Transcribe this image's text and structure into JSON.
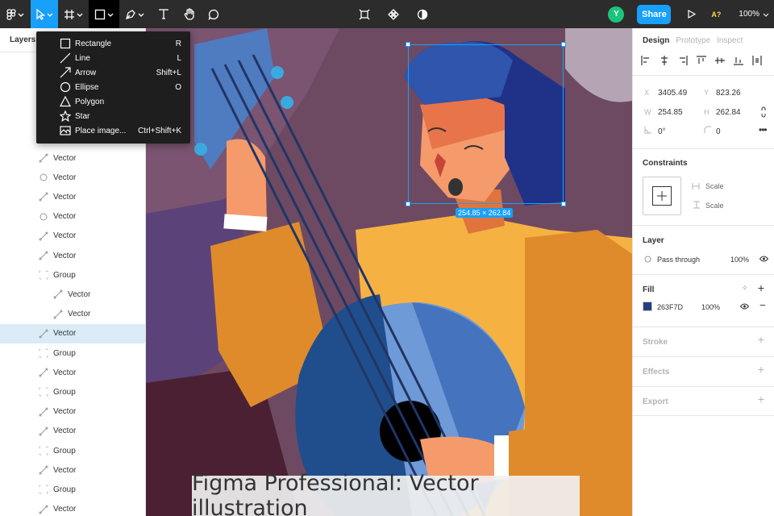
{
  "toolbar": {
    "zoom": "100%",
    "share_label": "Share",
    "avatar_initial": "Y",
    "badge": "A?"
  },
  "left_panel": {
    "header": "Layers",
    "layers": [
      {
        "label": "Vector",
        "icon": "vector-icon"
      },
      {
        "label": "Vector",
        "icon": "ellipse-icon"
      },
      {
        "label": "Vector",
        "icon": "vector-icon"
      },
      {
        "label": "Vector",
        "icon": "ellipse-icon"
      },
      {
        "label": "Vector",
        "icon": "vector-icon"
      },
      {
        "label": "Vector",
        "icon": "vector-icon"
      },
      {
        "label": "Group",
        "icon": "group-icon"
      },
      {
        "label": "Vector",
        "icon": "vector-icon",
        "indent": true
      },
      {
        "label": "Vector",
        "icon": "vector-icon",
        "indent": true
      },
      {
        "label": "Vector",
        "icon": "vector-icon",
        "selected": true
      },
      {
        "label": "Group",
        "icon": "group-icon"
      },
      {
        "label": "Vector",
        "icon": "vector-icon"
      },
      {
        "label": "Group",
        "icon": "group-icon"
      },
      {
        "label": "Vector",
        "icon": "vector-icon"
      },
      {
        "label": "Vector",
        "icon": "vector-icon"
      },
      {
        "label": "Group",
        "icon": "group-icon"
      },
      {
        "label": "Vector",
        "icon": "vector-icon"
      },
      {
        "label": "Group",
        "icon": "group-icon"
      },
      {
        "label": "Vector",
        "icon": "vector-icon"
      }
    ]
  },
  "dropdown": {
    "items": [
      {
        "label": "Rectangle",
        "shortcut": "R",
        "icon": "rectangle-icon"
      },
      {
        "label": "Line",
        "shortcut": "L",
        "icon": "line-icon"
      },
      {
        "label": "Arrow",
        "shortcut": "Shift+L",
        "icon": "arrow-icon"
      },
      {
        "label": "Ellipse",
        "shortcut": "O",
        "icon": "ellipse-icon"
      },
      {
        "label": "Polygon",
        "shortcut": "",
        "icon": "polygon-icon"
      },
      {
        "label": "Star",
        "shortcut": "",
        "icon": "star-icon"
      },
      {
        "label": "Place image...",
        "shortcut": "Ctrl+Shift+K",
        "icon": "image-icon"
      }
    ]
  },
  "canvas": {
    "selection_dimensions": "254.85 × 262.84",
    "caption": "Figma Professional: Vector illustration"
  },
  "right_panel": {
    "tabs": [
      "Design",
      "Prototype",
      "Inspect"
    ],
    "x_label": "X",
    "x_value": "3405.49",
    "y_label": "Y",
    "y_value": "823.26",
    "w_label": "W",
    "w_value": "254.85",
    "h_label": "H",
    "h_value": "262.84",
    "rotation": "0°",
    "radius": "0",
    "constraints_title": "Constraints",
    "constraint_h": "Scale",
    "constraint_v": "Scale",
    "layer_title": "Layer",
    "blend_mode": "Pass through",
    "layer_opacity": "100%",
    "fill_title": "Fill",
    "fill_hex": "263F7D",
    "fill_opacity": "100%",
    "fill_color": "#263f7d",
    "stroke_title": "Stroke",
    "effects_title": "Effects",
    "export_title": "Export"
  },
  "colors": {
    "accent": "#18a0fb",
    "toolbar_bg": "#2c2c2c"
  }
}
